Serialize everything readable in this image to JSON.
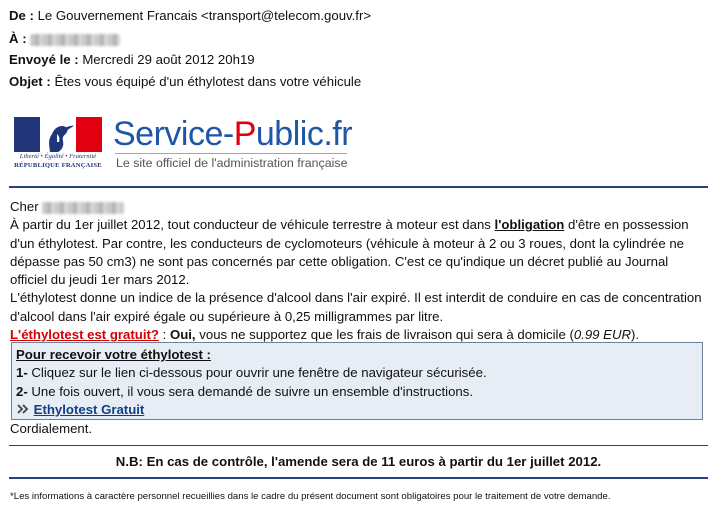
{
  "headers": {
    "from_label": "De :",
    "from_value": "Le Gouvernement Francais <transport@telecom.gouv.fr>",
    "to_label": "À :",
    "sent_label": "Envoyé le :",
    "sent_value": "Mercredi 29 août 2012 20h19",
    "subject_label": "Objet :",
    "subject_value": "Êtes vous équipé d'un éthylotest dans votre véhicule"
  },
  "logo": {
    "motto": "Liberté • Égalité • Fraternité",
    "republic": "RÉPUBLIQUE FRANÇAISE",
    "title_a": "Service-",
    "title_p": "P",
    "title_b": "ublic",
    "title_fr": ".fr",
    "subtitle": "Le site officiel de l'administration française"
  },
  "message": {
    "greeting": "Cher",
    "p1_a": "À partir du 1er juillet 2012, tout conducteur de véhicule terrestre à moteur est dans ",
    "p1_link": "l'obligation",
    "p1_b": " d'être en possession d'un éthylotest. Par contre, les conducteurs de cyclomoteurs (véhicule à moteur à 2 ou 3 roues, dont la cylindrée ne dépasse pas 50 cm3) ne sont pas concernés par cette obligation. C'est ce qu'indique un décret publié au Journal officiel du jeudi 1er mars 2012.",
    "p2": "L'éthylotest donne un indice de la présence d'alcool dans l'air expiré. Il est interdit de conduire en cas de concentration d'alcool dans l'air expiré égale ou supérieure à 0,25 milligrammes par litre.",
    "q_link": "L'éthylotest est gratuit?",
    "q_sep": " : ",
    "q_oui": "Oui,",
    "q_rest": " vous ne supportez que les frais de livraison qui sera à domicile (",
    "q_price": "0.99 EUR",
    "q_end": ")."
  },
  "box": {
    "title": "Pour recevoir votre éthylotest :",
    "step1_num": "1-",
    "step1": " Cliquez sur le lien ci-dessous pour ouvrir une fenêtre de navigateur sécurisée.",
    "step2_num": "2-",
    "step2": " Une fois ouvert, il vous sera demandé de suivre un ensemble d'instructions.",
    "cta": "Ethylotest Gratuit"
  },
  "closing": "Cordialement.",
  "nb": "N.B: En cas de contrôle, l'amende sera de 11 euros à partir du 1er juillet 2012.",
  "footnote": "*Les informations à caractère personnel recueillies dans le cadre du présent document sont obligatoires pour le traitement de votre demande.",
  "colors": {
    "brand_blue": "#1f56a5",
    "brand_red": "#e1000f",
    "rule_navy": "#25447a",
    "box_bg": "#e7edf4",
    "link_red": "#d40000"
  }
}
